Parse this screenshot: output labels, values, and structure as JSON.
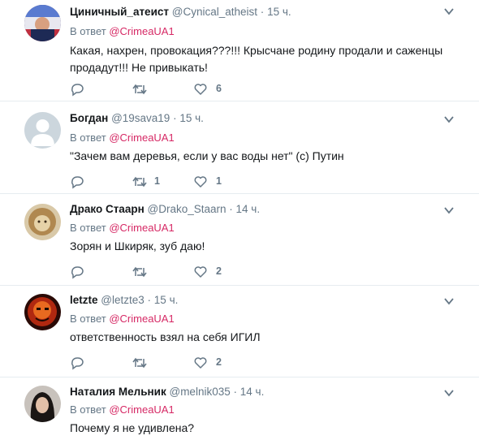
{
  "tweets": [
    {
      "name": "Циничный_атеист",
      "handle": "@Cynical_atheist",
      "time": "15 ч.",
      "reply_prefix": "В ответ",
      "reply_to": "@CrimeaUA1",
      "text": "Какая, нахрен, провокация???!!! Крысчане родину продали и саженцы продадут!!! Не привыкать!",
      "retweets": "",
      "likes": "6",
      "avatar": "flag-avatar"
    },
    {
      "name": "Богдан",
      "handle": "@19sava19",
      "time": "15 ч.",
      "reply_prefix": "В ответ",
      "reply_to": "@CrimeaUA1",
      "text": "\"Зачем вам деревья, если у вас воды нет\" (с) Путин",
      "retweets": "1",
      "likes": "1",
      "avatar": "default-avatar"
    },
    {
      "name": "Драко Стаарн",
      "handle": "@Drako_Staarn",
      "time": "14 ч.",
      "reply_prefix": "В ответ",
      "reply_to": "@CrimeaUA1",
      "text": "Зорян и Шкиряк, зуб даю!",
      "retweets": "",
      "likes": "2",
      "avatar": "lion-avatar"
    },
    {
      "name": "letzte",
      "handle": "@letzte3",
      "time": "15 ч.",
      "reply_prefix": "В ответ",
      "reply_to": "@CrimeaUA1",
      "text": "ответственность взял на себя ИГИЛ",
      "retweets": "",
      "likes": "2",
      "avatar": "fire-avatar"
    },
    {
      "name": "Наталия Мельник",
      "handle": "@melnik035",
      "time": "14 ч.",
      "reply_prefix": "В ответ",
      "reply_to": "@CrimeaUA1",
      "text": "Почему я не удивлена?",
      "retweets": "",
      "likes": "",
      "avatar": "woman-avatar"
    }
  ],
  "colors": {
    "link": "#d62965",
    "secondary": "#657786",
    "text": "#14171a",
    "divider": "#e6ecf0"
  }
}
